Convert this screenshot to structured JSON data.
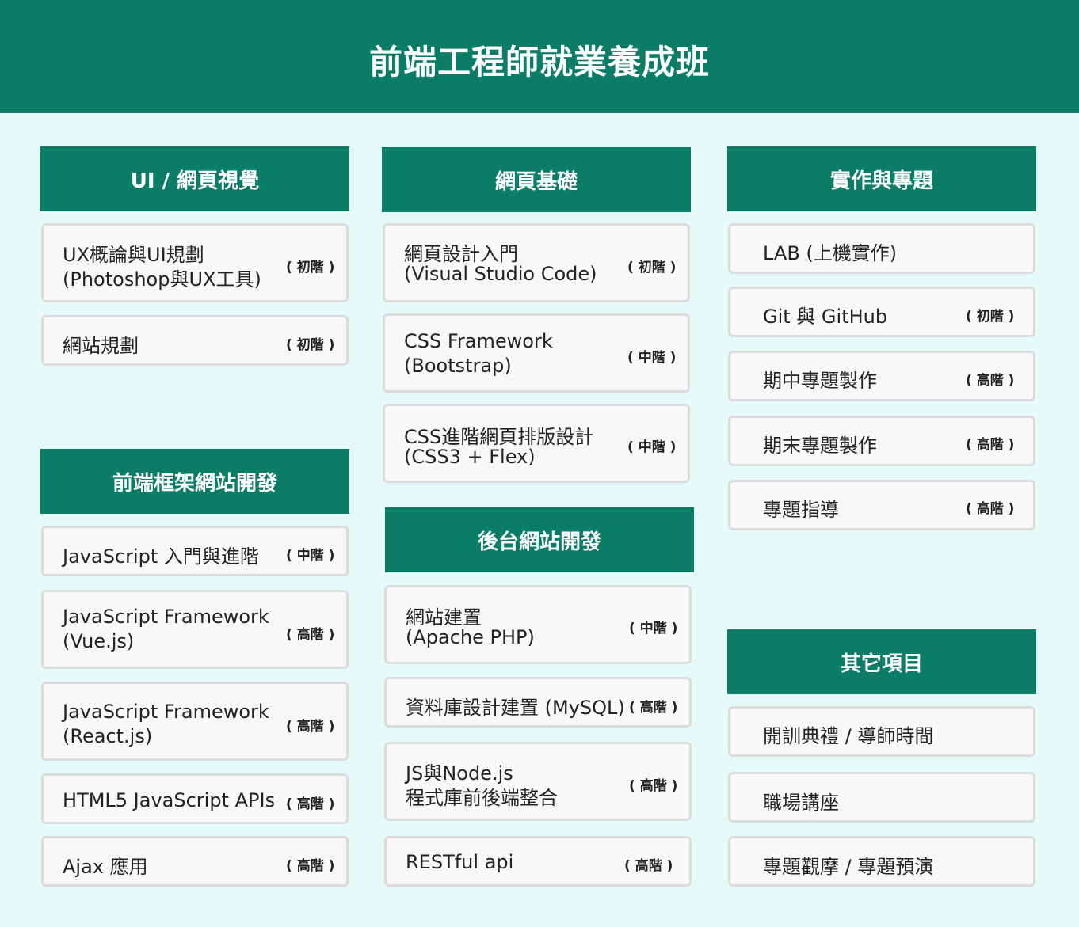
{
  "title": "前端工程師就業養成班",
  "columns": [
    {
      "sections": [
        {
          "header": "UI / 網頁視覺",
          "items": [
            {
              "lines": [
                "UX概論與UI規劃",
                "(Photoshop與UX工具)"
              ],
              "level": "( 初階 )"
            },
            {
              "lines": [
                "網站規劃"
              ],
              "level": "( 初階 )"
            }
          ]
        },
        {
          "header": "前端框架網站開發",
          "items": [
            {
              "lines": [
                "JavaScript 入門與進階"
              ],
              "level": "( 中階 )"
            },
            {
              "lines": [
                "JavaScript Framework",
                "(Vue.js)"
              ],
              "level": "( 高階 )"
            },
            {
              "lines": [
                "JavaScript Framework",
                "(React.js)"
              ],
              "level": "( 高階 )"
            },
            {
              "lines": [
                "HTML5 JavaScript APIs"
              ],
              "level": "( 高階 )"
            },
            {
              "lines": [
                "Ajax 應用"
              ],
              "level": "( 高階 )"
            }
          ]
        }
      ]
    },
    {
      "sections": [
        {
          "header": "網頁基礎",
          "items": [
            {
              "lines": [
                "網頁設計入門",
                "(Visual Studio Code)"
              ],
              "level": "( 初階 )"
            },
            {
              "lines": [
                "CSS Framework",
                "(Bootstrap)"
              ],
              "level": "( 中階 )"
            },
            {
              "lines": [
                "CSS進階網頁排版設計",
                "(CSS3 + Flex)"
              ],
              "level": "( 中階 )"
            }
          ]
        },
        {
          "header": "後台網站開發",
          "items": [
            {
              "lines": [
                "網站建置",
                "(Apache PHP)"
              ],
              "level": "( 中階 )"
            },
            {
              "lines": [
                "資料庫設計建置 (MySQL)"
              ],
              "level": "( 高階 )"
            },
            {
              "lines": [
                "JS與Node.js",
                "程式庫前後端整合"
              ],
              "level": "( 高階 )"
            },
            {
              "lines": [
                "RESTful api"
              ],
              "level": "( 高階 )"
            }
          ]
        }
      ]
    },
    {
      "sections": [
        {
          "header": "實作與專題",
          "items": [
            {
              "lines": [
                "LAB (上機實作)"
              ],
              "level": ""
            },
            {
              "lines": [
                "Git 與 GitHub"
              ],
              "level": "( 初階 )"
            },
            {
              "lines": [
                "期中專題製作"
              ],
              "level": "( 高階 )"
            },
            {
              "lines": [
                "期末專題製作"
              ],
              "level": "( 高階 )"
            },
            {
              "lines": [
                "專題指導"
              ],
              "level": "( 高階 )"
            }
          ]
        },
        {
          "header": "其它項目",
          "items": [
            {
              "lines": [
                "開訓典禮 / 導師時間"
              ],
              "level": ""
            },
            {
              "lines": [
                "職場講座"
              ],
              "level": ""
            },
            {
              "lines": [
                "專題觀摩 / 專題預演"
              ],
              "level": ""
            }
          ]
        }
      ]
    }
  ]
}
